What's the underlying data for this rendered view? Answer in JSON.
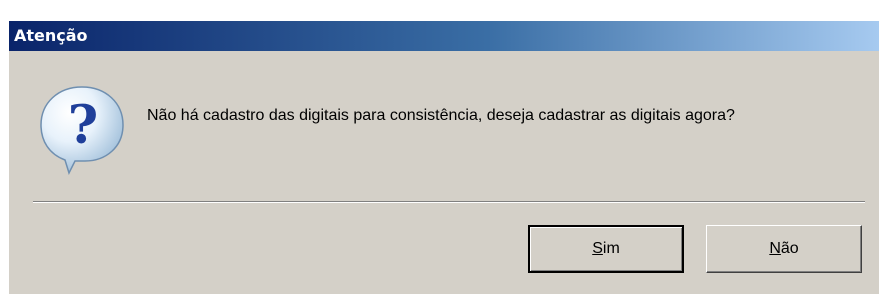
{
  "dialog": {
    "title": "Atenção",
    "icon": "question-icon",
    "message": "Não há cadastro das digitais para consistência, deseja cadastrar as digitais agora?"
  },
  "buttons": {
    "yes": {
      "accel": "S",
      "rest": "im"
    },
    "no": {
      "accel": "N",
      "rest": "ão"
    }
  },
  "colors": {
    "titlebar_start": "#0a246a",
    "titlebar_end": "#a6caf0",
    "dialog_bg": "#d4d0c8"
  }
}
